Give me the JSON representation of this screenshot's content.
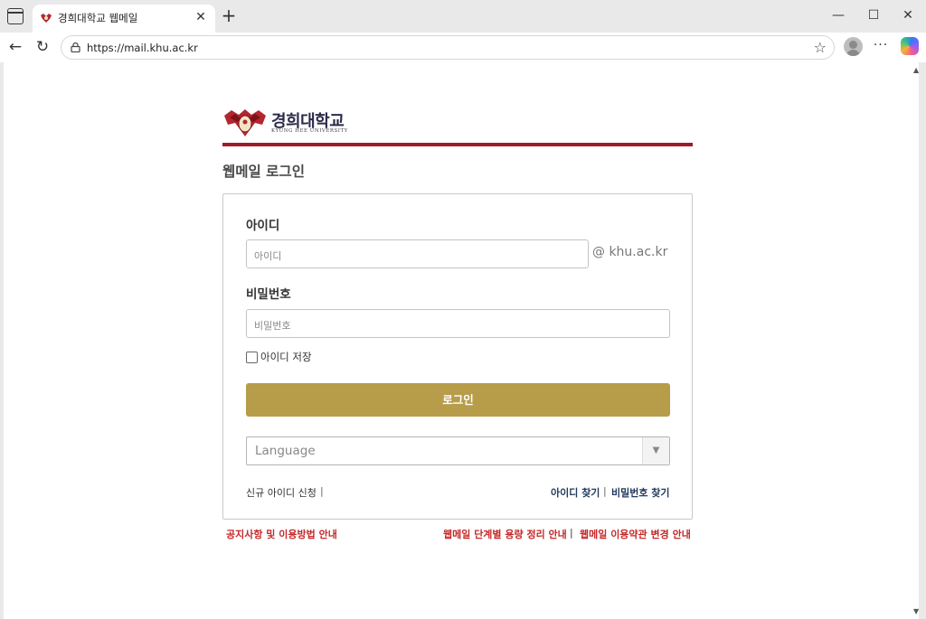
{
  "browser": {
    "tab_title": "경희대학교 웹메일",
    "tab_close": "✕",
    "new_tab": "+",
    "url": "https://mail.khu.ac.kr",
    "controls": {
      "minimize": "—",
      "maximize": "☐",
      "close": "✕"
    },
    "nav": {
      "back": "←",
      "reload": "↻",
      "more": "···",
      "star": "☆"
    }
  },
  "logo": {
    "name_ko": "경희대학교",
    "name_en": "KYUNG HEE UNIVERSITY",
    "brand_color": "#9c1b26"
  },
  "page": {
    "title": "웹메일 로그인"
  },
  "form": {
    "id_label": "아이디",
    "id_placeholder": "아이디",
    "domain": "@ khu.ac.kr",
    "pw_label": "비밀번호",
    "pw_placeholder": "비밀번호",
    "save_id_label": "아이디 저장",
    "save_id_checked": false,
    "login_button": "로그인",
    "login_button_color": "#b79c4a",
    "language_placeholder": "Language",
    "dropdown_arrow": "▼"
  },
  "links": {
    "signup": "신규 아이디 신청",
    "separator": "|",
    "find_id": "아이디 찾기",
    "find_pw": "비밀번호 찾기"
  },
  "footer": {
    "notice": "공지사항 및 이용방법 안내",
    "capacity": "웹메일 단계별 용량 정리 안내",
    "separator": "|",
    "terms": "웹메일 이용약관 변경 안내",
    "color": "#c62828"
  }
}
